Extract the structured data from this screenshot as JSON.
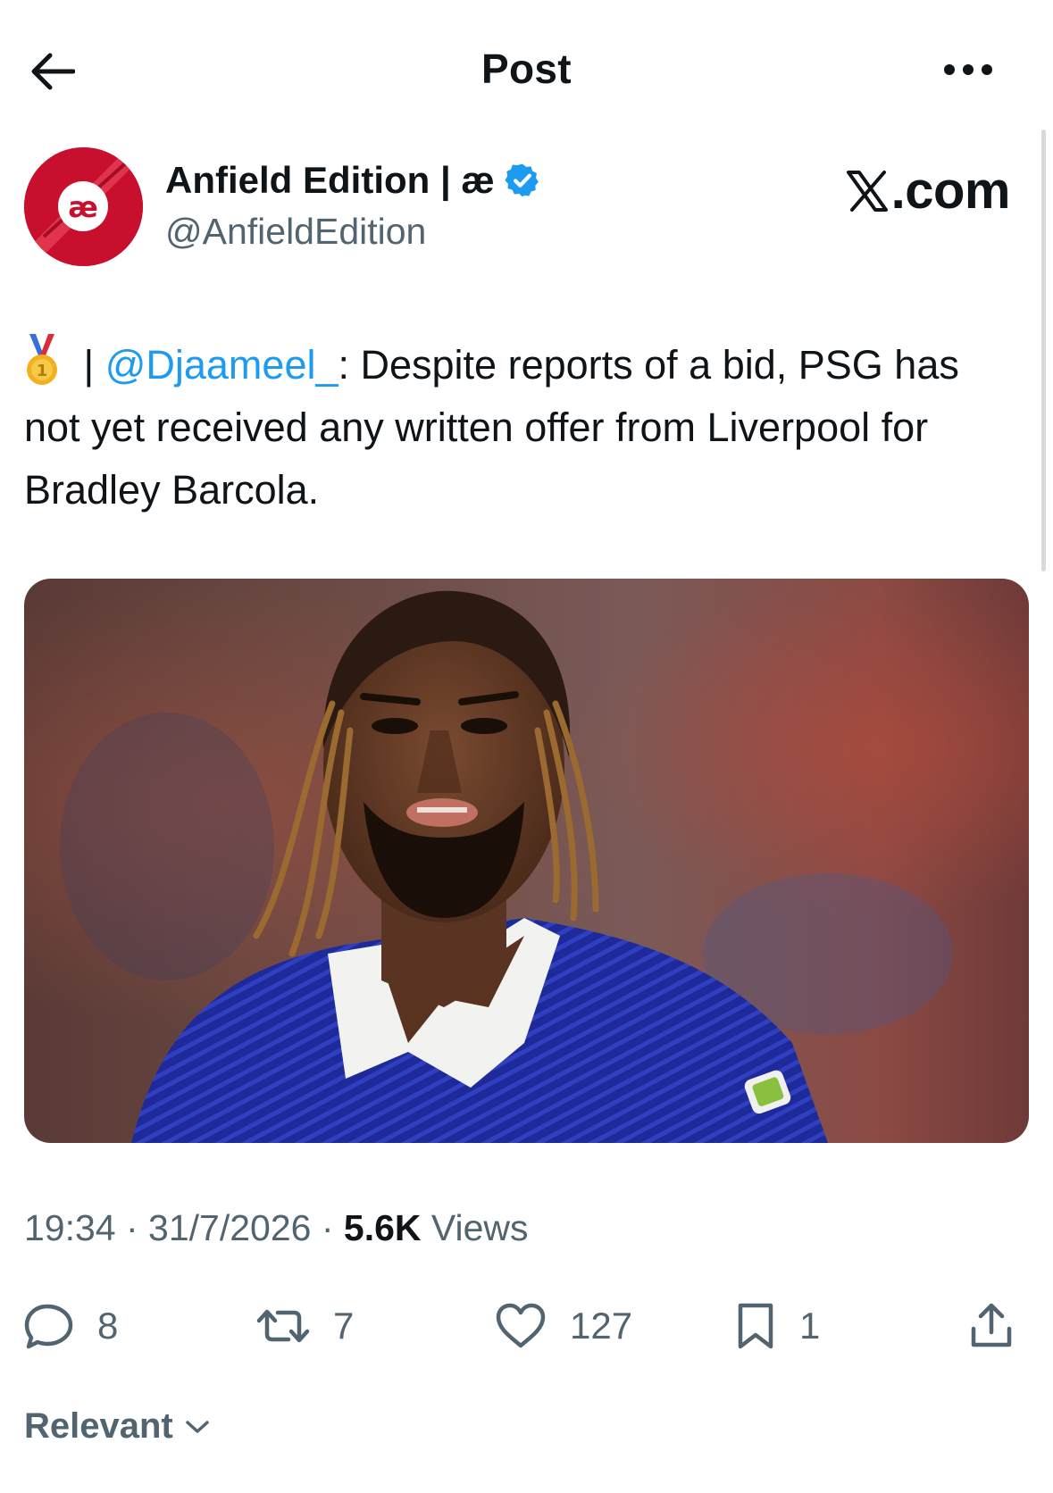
{
  "header": {
    "title": "Post",
    "back_icon": "arrow-left-icon",
    "more_icon": "more-horizontal-icon"
  },
  "author": {
    "name": "Anfield Edition | æ",
    "handle": "@AnfieldEdition",
    "avatar_text": "æ",
    "verified": true,
    "avatar_color": "#c8102e"
  },
  "watermark": {
    "text": ".com",
    "logo": "x-logo-icon"
  },
  "post": {
    "emoji": "🥇",
    "separator": " | ",
    "mention": "@Djaameel_",
    "text": ": Despite reports of a bid, PSG has not yet received any written offer from Liverpool for Bradley Barcola."
  },
  "media": {
    "type": "photo",
    "alt": "footballer-photo"
  },
  "meta": {
    "time": "19:34",
    "dot1": " · ",
    "date": "31/7/2026",
    "dot2": " · ",
    "views_count": "5.6K",
    "views_label": " Views"
  },
  "actions": {
    "replies": "8",
    "reposts": "7",
    "likes": "127",
    "bookmarks": "1"
  },
  "sort": {
    "label": "Relevant"
  },
  "colors": {
    "accent": "#1d9bf0",
    "secondary_text": "#536471",
    "primary_text": "#0f1419"
  }
}
